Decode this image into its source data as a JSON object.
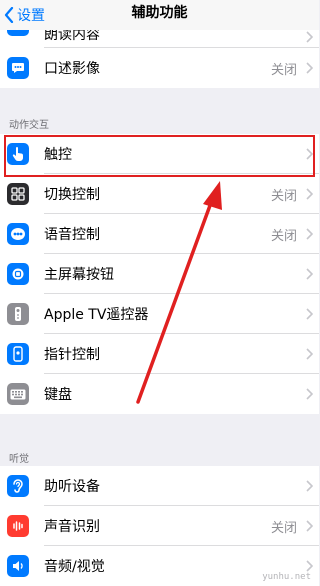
{
  "navbar": {
    "back_label": "设置",
    "title": "辅助功能"
  },
  "top_partial": {
    "label": "朗读内容",
    "icon": "speech-bubble-icon",
    "color": "#007aff"
  },
  "spoken_row": {
    "label": "口述影像",
    "value": "关闭",
    "icon": "speech-bubble-icon",
    "color": "#007aff"
  },
  "interaction": {
    "header": "动作交互",
    "items": [
      {
        "label": "触控",
        "value": "",
        "icon": "hand-pointer-icon",
        "color": "#007aff"
      },
      {
        "label": "切换控制",
        "value": "关闭",
        "icon": "grid-squares-icon",
        "color": "#2b2b2e"
      },
      {
        "label": "语音控制",
        "value": "关闭",
        "icon": "voice-control-icon",
        "color": "#007aff"
      },
      {
        "label": "主屏幕按钮",
        "value": "",
        "icon": "home-button-icon",
        "color": "#007aff"
      },
      {
        "label": "Apple TV遥控器",
        "value": "",
        "icon": "remote-icon",
        "color": "#8e8e93"
      },
      {
        "label": "指针控制",
        "value": "",
        "icon": "pointer-icon",
        "color": "#007aff"
      },
      {
        "label": "键盘",
        "value": "",
        "icon": "keyboard-icon",
        "color": "#8e8e93"
      }
    ]
  },
  "hearing": {
    "header": "听觉",
    "items": [
      {
        "label": "助听设备",
        "value": "",
        "icon": "ear-icon",
        "color": "#007aff"
      },
      {
        "label": "声音识别",
        "value": "关闭",
        "icon": "sound-wave-icon",
        "color": "#ff3b30"
      },
      {
        "label": "音频/视觉",
        "value": "",
        "icon": "speaker-icon",
        "color": "#007aff"
      }
    ]
  },
  "annotation": {
    "highlight_color": "#e02020",
    "arrow_color": "#e02020"
  },
  "watermark": "yunhu.net"
}
